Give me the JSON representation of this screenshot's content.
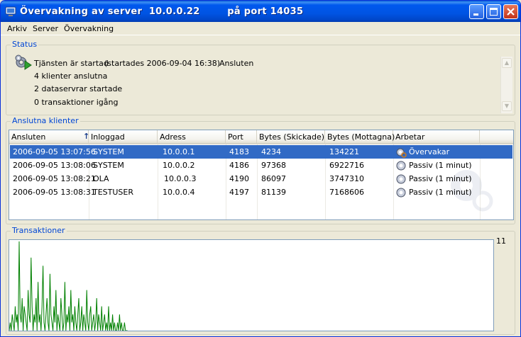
{
  "window": {
    "title": "Övervakning av server  10.0.0.22        på port 14035"
  },
  "menu": [
    "Arkiv",
    "Server",
    "Övervakning"
  ],
  "status": {
    "label": "Status",
    "line1": "Tjänsten är startad",
    "started": "(startades 2006-09-04 16:38)",
    "connection": "Ansluten",
    "line2": "4 klienter anslutna",
    "line3": "2 dataservrar startade",
    "line4": "0 transaktioner igång"
  },
  "clients": {
    "label": "Anslutna klienter",
    "columns": [
      "Ansluten",
      "Inloggad",
      "Adress",
      "Port",
      "Bytes (Skickade)",
      "Bytes (Mottagna)",
      "Arbetar"
    ],
    "sort_indicator": "↑",
    "rows": [
      {
        "ansluten": "2006-09-05 13:07:56",
        "inloggad": "SYSTEM",
        "adress": "10.0.0.1",
        "port": "4183",
        "skickade": "4234",
        "mottagna": "134221",
        "arbetar": "Övervakar"
      },
      {
        "ansluten": "2006-09-05 13:08:06",
        "inloggad": "SYSTEM",
        "adress": "10.0.0.2",
        "port": "4186",
        "skickade": "97368",
        "mottagna": "6922716",
        "arbetar": "Passiv (1 minut)"
      },
      {
        "ansluten": "2006-09-05 13:08:21",
        "inloggad": "OLA",
        "adress": "10.0.0.3",
        "port": "4190",
        "skickade": "86097",
        "mottagna": "3747310",
        "arbetar": "Passiv (1 minut)"
      },
      {
        "ansluten": "2006-09-05 13:08:31",
        "inloggad": "TESTUSER",
        "adress": "10.0.0.4",
        "port": "4197",
        "skickade": "81139",
        "mottagna": "7168606",
        "arbetar": "Passiv (1 minut)"
      }
    ],
    "selected_row": 0
  },
  "transactions": {
    "label": "Transaktioner",
    "max_label": "11"
  },
  "chart_data": {
    "type": "line",
    "series_color": "#008000",
    "ylim": [
      0,
      11
    ],
    "values": [
      0,
      1,
      0,
      2,
      1,
      0,
      3,
      1,
      2,
      0,
      11,
      2,
      1,
      4,
      0,
      3,
      2,
      1,
      0,
      5,
      2,
      1,
      9,
      3,
      0,
      2,
      1,
      4,
      0,
      6,
      1,
      2,
      0,
      3,
      8,
      1,
      0,
      2,
      4,
      1,
      0,
      7,
      2,
      1,
      0,
      3,
      1,
      5,
      0,
      2,
      1,
      0,
      4,
      2,
      0,
      1,
      6,
      0,
      2,
      1,
      3,
      0,
      5,
      1,
      2,
      0,
      3,
      1,
      0,
      2,
      4,
      0,
      1,
      3,
      0,
      2,
      1,
      0,
      5,
      1,
      0,
      2,
      3,
      0,
      1,
      2,
      0,
      1,
      4,
      0,
      2,
      1,
      0,
      3,
      0,
      1,
      2,
      0,
      1,
      0,
      3,
      0,
      1,
      0,
      2,
      0,
      1,
      0,
      0,
      1,
      0,
      2,
      0,
      1,
      0,
      0,
      1,
      0,
      0,
      0
    ]
  },
  "colors": {
    "selection": "#316ac5",
    "group_label": "#0046d5",
    "graph_line": "#008000"
  }
}
